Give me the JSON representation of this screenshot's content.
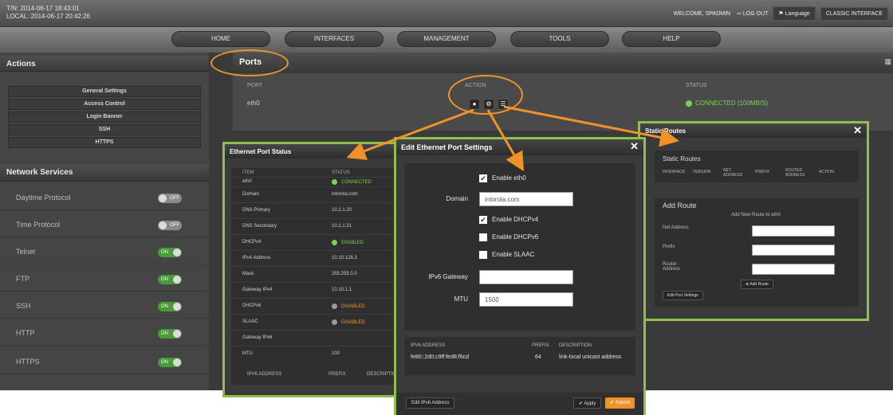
{
  "header": {
    "tz_utc": "T/N: 2014-06-17 18:43:01",
    "tz_local": "LOCAL: 2014-06-17 20:42:26",
    "welcome": "WELCOME, SPADMIN",
    "logout": "LOG OUT",
    "language": "Language",
    "classic": "CLASSIC INTERFACE"
  },
  "nav": [
    "HOME",
    "INTERFACES",
    "MANAGEMENT",
    "TOOLS",
    "HELP"
  ],
  "actions": {
    "title": "Actions",
    "items": [
      "General Settings",
      "Access Control",
      "Login Banner",
      "SSH",
      "HTTPS"
    ]
  },
  "network_services": {
    "title": "Network Services",
    "items": [
      {
        "label": "Daytime Protocol",
        "state": "OFF"
      },
      {
        "label": "Time Protocol",
        "state": "OFF"
      },
      {
        "label": "Telnet",
        "state": "ON"
      },
      {
        "label": "FTP",
        "state": "ON"
      },
      {
        "label": "SSH",
        "state": "ON"
      },
      {
        "label": "HTTP",
        "state": "ON"
      },
      {
        "label": "HTTPS",
        "state": "ON"
      }
    ]
  },
  "ports": {
    "title": "Ports",
    "col_port": "PORT",
    "col_action": "ACTION",
    "col_status": "STATUS",
    "row_port": "eth0",
    "row_status": "CONNECTED (100MB/S)"
  },
  "eth_status": {
    "title": "Ethernet Port Status",
    "col_item": "ITEM",
    "col_status": "STATUS",
    "rows": [
      {
        "k": "eth0",
        "v": "CONNECTED"
      },
      {
        "k": "Domain",
        "v": "intorola.com"
      },
      {
        "k": "DNS Primary",
        "v": "10.1.1.20"
      },
      {
        "k": "DNS Secondary",
        "v": "10.1.1.31"
      },
      {
        "k": "DHCPv4",
        "v": "ENABLED"
      },
      {
        "k": "IPv4 Address",
        "v": "10.10.128.3"
      },
      {
        "k": "Mask",
        "v": "255.255.0.0"
      },
      {
        "k": "Gateway IPv4",
        "v": "10.10.1.1"
      },
      {
        "k": "DHCPv6",
        "v": "DISABLED"
      },
      {
        "k": "SLAAC",
        "v": "DISABLED"
      },
      {
        "k": "Gateway IPv6",
        "v": ""
      },
      {
        "k": "MTU",
        "v": "100"
      }
    ],
    "ipv6_col1": "IPV6 ADDRESS",
    "ipv6_col2": "PREFIX",
    "ipv6_col3": "DESCRIPTION"
  },
  "edit_eth": {
    "title": "Edit Ethernet Port Settings",
    "enable_eth0": "Enable eth0",
    "domain_label": "Domain",
    "domain_value": "intorola.com",
    "dhcpv4": "Enable DHCPv4",
    "dhcpv6": "Enable DHCPv6",
    "slaac": "Enable SLAAC",
    "ipv6_gw_label": "IPv6 Gateway",
    "mtu_label": "MTU",
    "mtu_value": "1500",
    "col_addr": "IPV6 ADDRESS",
    "col_prefix": "PREFIX",
    "col_desc": "DESCRIPTION",
    "addr": "fe80::2d0:c9ff:fed8:f6cd",
    "prefix": "64",
    "desc": "link-local unicast address",
    "edit_ipv6_btn": "Edit IPv6 Address",
    "apply_btn": "Apply",
    "submit_btn": "Submit"
  },
  "static_routes": {
    "title": "Static Routes",
    "section": "Static Routes",
    "cols": [
      "INTERFACE",
      "VERSION",
      "NET ADDRESS",
      "PREFIX",
      "ROUTER ADDRESS",
      "ACTION"
    ],
    "add_title": "Add Route",
    "add_subtitle": "Add New Route to eth0",
    "net_label": "Net Address",
    "prefix_label": "Prefix",
    "router_label": "Router Address",
    "add_btn": "Add Route",
    "edit_btn": "Edit Port Settings"
  },
  "colors": {
    "accent": "#8dc04e",
    "highlight": "#f0922a",
    "connected": "#7ccf5a"
  }
}
